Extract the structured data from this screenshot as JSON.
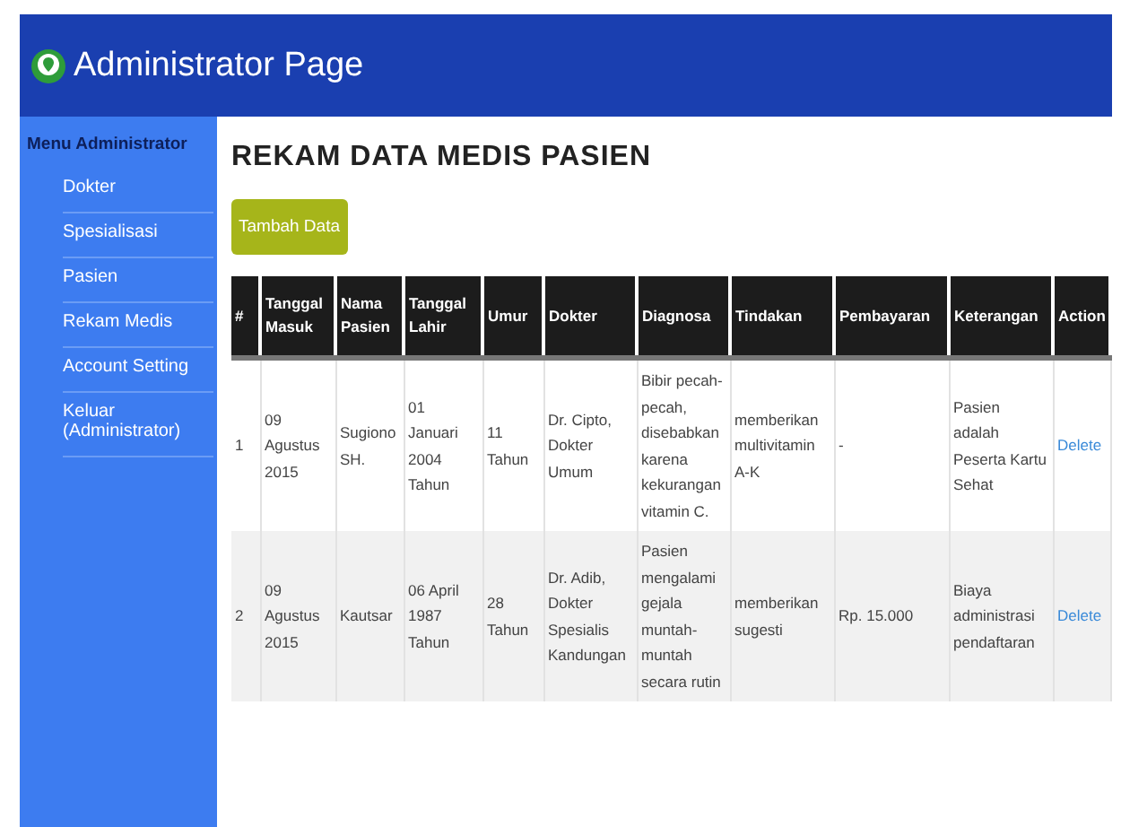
{
  "header": {
    "title": "Administrator Page"
  },
  "sidebar": {
    "heading": "Menu Administrator",
    "items": [
      {
        "label": "Dokter"
      },
      {
        "label": "Spesialisasi"
      },
      {
        "label": "Pasien"
      },
      {
        "label": "Rekam Medis"
      },
      {
        "label": "Account Setting"
      },
      {
        "label": "Keluar (Administrator)"
      }
    ]
  },
  "page_title": "REKAM DATA MEDIS PASIEN",
  "add_button": "Tambah Data",
  "table": {
    "columns": [
      "#",
      "Tanggal Masuk",
      "Nama Pasien",
      "Tanggal Lahir",
      "Umur",
      "Dokter",
      "Diagnosa",
      "Tindakan",
      "Pembayaran",
      "Keterangan",
      "Action"
    ],
    "rows": [
      {
        "cells": [
          "1",
          "09 Agustus 2015",
          "Sugiono SH.",
          "01 Januari 2004 Tahun",
          "11 Tahun",
          "Dr. Cipto, Dokter Umum",
          "Bibir pecah-pecah, disebabkan karena kekurangan vitamin C.",
          "memberikan multivitamin A-K",
          "-",
          "Pasien adalah Peserta Kartu Sehat"
        ],
        "action": "Delete"
      },
      {
        "cells": [
          "2",
          "09 Agustus 2015",
          "Kautsar",
          "06 April 1987 Tahun",
          "28 Tahun",
          "Dr. Adib, Dokter Spesialis Kandungan",
          "Pasien mengalami gejala muntah-muntah secara rutin",
          "memberikan sugesti",
          "Rp. 15.000",
          "Biaya administrasi pendaftaran"
        ],
        "action": "Delete"
      }
    ]
  }
}
